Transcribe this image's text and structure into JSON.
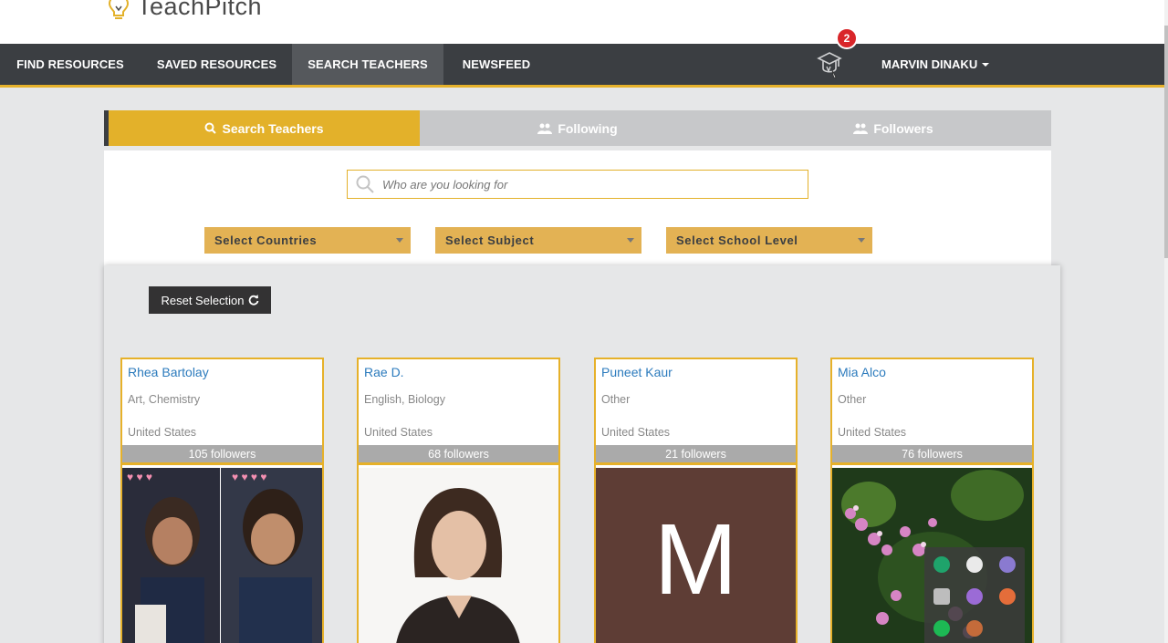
{
  "brand": {
    "logo_text": "TeachPitch"
  },
  "nav": {
    "items": [
      {
        "label": "FIND RESOURCES"
      },
      {
        "label": "SAVED RESOURCES"
      },
      {
        "label": "SEARCH TEACHERS"
      },
      {
        "label": "NEWSFEED"
      }
    ],
    "notification_count": "2",
    "user_name": "MARVIN DINAKU"
  },
  "tabs": [
    {
      "label": "Search Teachers",
      "icon": "search-icon"
    },
    {
      "label": "Following",
      "icon": "users-icon"
    },
    {
      "label": "Followers",
      "icon": "users-icon"
    }
  ],
  "search": {
    "placeholder": "Who are you looking for"
  },
  "filters": [
    {
      "label": "Select Countries"
    },
    {
      "label": "Select Subject"
    },
    {
      "label": "Select School Level"
    }
  ],
  "reset_label": "Reset Selection",
  "teachers": [
    {
      "name": "Rhea Bartolay",
      "subjects": "Art, Chemistry",
      "country": "United States",
      "followers": "105 followers"
    },
    {
      "name": "Rae D.",
      "subjects": "English, Biology",
      "country": "United States",
      "followers": "68 followers"
    },
    {
      "name": "Puneet Kaur",
      "subjects": "Other",
      "country": "United States",
      "followers": "21 followers",
      "avatar_letter": "M"
    },
    {
      "name": "Mia Alco",
      "subjects": "Other",
      "country": "United States",
      "followers": "76 followers"
    }
  ],
  "colors": {
    "accent": "#e3b12a",
    "navbar": "#3b3e42",
    "link": "#2c7bbd",
    "badge": "#d9262a"
  }
}
